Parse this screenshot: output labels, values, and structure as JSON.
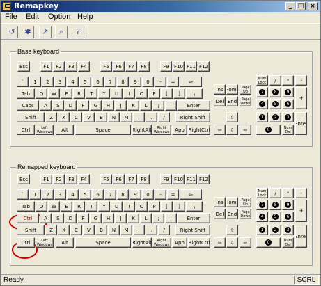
{
  "app": {
    "title": "Remapkey"
  },
  "window_controls": {
    "minimize": "_",
    "maximize": "□",
    "close": "×"
  },
  "menu": [
    "File",
    "Edit",
    "Option",
    "Help"
  ],
  "toolbar": [
    {
      "name": "open-tool-icon",
      "glyph": "↺"
    },
    {
      "name": "save-tool-icon",
      "glyph": "✱"
    },
    {
      "name": "remap-tool-icon",
      "glyph": "↗"
    },
    {
      "name": "view-tool-icon",
      "glyph": "⌕"
    },
    {
      "name": "help-tool-icon",
      "glyph": "?"
    }
  ],
  "base": {
    "label": "Base keyboard",
    "fn_row": [
      "Esc",
      "F1",
      "F2",
      "F3",
      "F4",
      "F5",
      "F6",
      "F7",
      "F8",
      "F9",
      "F10",
      "F11",
      "F12"
    ],
    "row1": [
      "`",
      "1",
      "2",
      "3",
      "4",
      "5",
      "6",
      "7",
      "8",
      "9",
      "0",
      "-",
      "=",
      "⇦"
    ],
    "row2": [
      "Tab",
      "Q",
      "W",
      "E",
      "R",
      "T",
      "Y",
      "U",
      "I",
      "O",
      "P",
      "[",
      "]",
      "\\"
    ],
    "row3": [
      "Caps",
      "A",
      "S",
      "D",
      "F",
      "G",
      "H",
      "J",
      "K",
      "L",
      ";",
      "'",
      "Enter"
    ],
    "row4": [
      "Shift",
      "Z",
      "X",
      "C",
      "V",
      "B",
      "N",
      "M",
      ",",
      ".",
      "/",
      "Right Shift"
    ],
    "row5": [
      "Ctrl",
      "Left Windows",
      "Alt",
      "Space",
      "RightAlt",
      "Right Windows",
      "App",
      "RightCtrl"
    ],
    "nav1": [
      "Ins",
      "Home",
      "Page Up"
    ],
    "nav2": [
      "Del",
      "End",
      "Page Down"
    ],
    "arrows": [
      "⇧",
      "⇦",
      "⇩",
      "⇨"
    ],
    "numpad": {
      "row1": [
        "Num Lock",
        "/",
        "*",
        "-"
      ],
      "row2": [
        "7",
        "8",
        "9"
      ],
      "row3": [
        "4",
        "5",
        "6"
      ],
      "row4": [
        "1",
        "2",
        "3"
      ],
      "row5": [
        "0",
        "Num Del"
      ],
      "plus": "+",
      "enter": "Enter"
    }
  },
  "remapped": {
    "label": "Remapped keyboard",
    "fn_row": [
      "Esc",
      "F1",
      "F2",
      "F3",
      "F4",
      "F5",
      "F6",
      "F7",
      "F8",
      "F9",
      "F10",
      "F11",
      "F12"
    ],
    "row1": [
      "`",
      "1",
      "2",
      "3",
      "4",
      "5",
      "6",
      "7",
      "8",
      "9",
      "0",
      "-",
      "=",
      "⇦"
    ],
    "row2": [
      "Tab",
      "Q",
      "W",
      "E",
      "R",
      "T",
      "Y",
      "U",
      "I",
      "O",
      "P",
      "[",
      "]",
      "\\"
    ],
    "row3": [
      "Ctrl",
      "A",
      "S",
      "D",
      "F",
      "G",
      "H",
      "J",
      "K",
      "L",
      ";",
      "'",
      "Enter"
    ],
    "row4": [
      "Shift",
      "Z",
      "X",
      "C",
      "V",
      "B",
      "N",
      "M",
      ",",
      ".",
      "/",
      "Right Shift"
    ],
    "row5": [
      "Ctrl",
      "Left Windows",
      "Alt",
      "Space",
      "RightAlt",
      "Right Windows",
      "App",
      "RightCtrl"
    ],
    "nav1": [
      "Ins",
      "Home",
      "Page Up"
    ],
    "nav2": [
      "Del",
      "End",
      "Page Down"
    ],
    "arrows": [
      "⇧",
      "⇦",
      "⇩",
      "⇨"
    ],
    "numpad": {
      "row1": [
        "Num Lock",
        "/",
        "*",
        "-"
      ],
      "row2": [
        "7",
        "8",
        "9"
      ],
      "row3": [
        "4",
        "5",
        "6"
      ],
      "row4": [
        "1",
        "2",
        "3"
      ],
      "row5": [
        "0",
        "Num Del"
      ],
      "plus": "+",
      "enter": "Enter"
    }
  },
  "status": {
    "left": "Ready",
    "right": "SCRL"
  },
  "colors": {
    "highlight_red": "#d00000",
    "remapped_key_text": "#c00000"
  }
}
